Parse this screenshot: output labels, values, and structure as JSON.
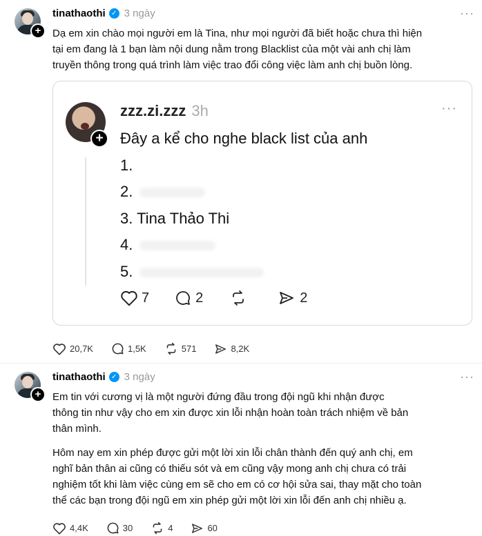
{
  "post1": {
    "username": "tinathaothi",
    "time": "3 ngày",
    "lines": [
      "Dạ em xin chào mọi người em là Tina, như mọi người đã biết hoặc chưa thì hiện",
      "tại em đang là 1 bạn làm nội dung nằm trong Blacklist của một vài anh chị làm",
      "truyền thông trong quá trình làm việc trao đổi công việc làm anh chị buồn lòng."
    ],
    "quote": {
      "username": "zzz.zi.zzz",
      "time": "3h",
      "lines": [
        "Đây a kể cho nghe black list của anh",
        "1.",
        "2.",
        "3. Tina Thảo Thi",
        "4.",
        "5."
      ],
      "likes": "7",
      "replies": "2",
      "shares": "2"
    },
    "likes": "20,7K",
    "replies": "1,5K",
    "reposts": "571",
    "shares": "8,2K"
  },
  "post2": {
    "username": "tinathaothi",
    "time": "3 ngày",
    "para1": [
      "Em tin với cương vị là một người đứng đầu trong đội ngũ khi nhận được",
      "thông tin như vậy cho em xin được xin lỗi nhận hoàn toàn trách nhiệm về bản",
      "thân mình."
    ],
    "para2": [
      "Hôm nay em xin phép được gửi một lời xin lỗi chân thành đến quý anh chị, em",
      "nghĩ bản thân ai cũng có thiếu sót và em cũng vậy mong anh chị chưa có trải",
      "nghiệm tốt khi làm việc cùng em sẽ cho em có cơ hội sửa sai, thay mặt cho toàn",
      "thể các bạn trong đội ngũ em xin phép gửi một lời xin lỗi đến anh chị nhiều ạ."
    ],
    "likes": "4,4K",
    "replies": "30",
    "reposts": "4",
    "shares": "60"
  },
  "icons": {
    "like": "heart-icon",
    "reply": "comment-icon",
    "repost": "repost-icon",
    "share": "send-icon",
    "more": "more-dots-icon",
    "follow": "plus-icon",
    "verified": "verified-badge-icon"
  }
}
